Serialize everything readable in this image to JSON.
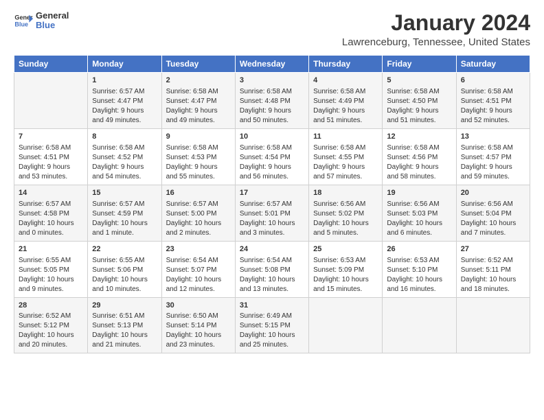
{
  "header": {
    "logo_line1": "General",
    "logo_line2": "Blue",
    "title": "January 2024",
    "subtitle": "Lawrenceburg, Tennessee, United States"
  },
  "days_of_week": [
    "Sunday",
    "Monday",
    "Tuesday",
    "Wednesday",
    "Thursday",
    "Friday",
    "Saturday"
  ],
  "weeks": [
    [
      {
        "day": "",
        "info": ""
      },
      {
        "day": "1",
        "info": "Sunrise: 6:57 AM\nSunset: 4:47 PM\nDaylight: 9 hours\nand 49 minutes."
      },
      {
        "day": "2",
        "info": "Sunrise: 6:58 AM\nSunset: 4:47 PM\nDaylight: 9 hours\nand 49 minutes."
      },
      {
        "day": "3",
        "info": "Sunrise: 6:58 AM\nSunset: 4:48 PM\nDaylight: 9 hours\nand 50 minutes."
      },
      {
        "day": "4",
        "info": "Sunrise: 6:58 AM\nSunset: 4:49 PM\nDaylight: 9 hours\nand 51 minutes."
      },
      {
        "day": "5",
        "info": "Sunrise: 6:58 AM\nSunset: 4:50 PM\nDaylight: 9 hours\nand 51 minutes."
      },
      {
        "day": "6",
        "info": "Sunrise: 6:58 AM\nSunset: 4:51 PM\nDaylight: 9 hours\nand 52 minutes."
      }
    ],
    [
      {
        "day": "7",
        "info": "Sunrise: 6:58 AM\nSunset: 4:51 PM\nDaylight: 9 hours\nand 53 minutes."
      },
      {
        "day": "8",
        "info": "Sunrise: 6:58 AM\nSunset: 4:52 PM\nDaylight: 9 hours\nand 54 minutes."
      },
      {
        "day": "9",
        "info": "Sunrise: 6:58 AM\nSunset: 4:53 PM\nDaylight: 9 hours\nand 55 minutes."
      },
      {
        "day": "10",
        "info": "Sunrise: 6:58 AM\nSunset: 4:54 PM\nDaylight: 9 hours\nand 56 minutes."
      },
      {
        "day": "11",
        "info": "Sunrise: 6:58 AM\nSunset: 4:55 PM\nDaylight: 9 hours\nand 57 minutes."
      },
      {
        "day": "12",
        "info": "Sunrise: 6:58 AM\nSunset: 4:56 PM\nDaylight: 9 hours\nand 58 minutes."
      },
      {
        "day": "13",
        "info": "Sunrise: 6:58 AM\nSunset: 4:57 PM\nDaylight: 9 hours\nand 59 minutes."
      }
    ],
    [
      {
        "day": "14",
        "info": "Sunrise: 6:57 AM\nSunset: 4:58 PM\nDaylight: 10 hours\nand 0 minutes."
      },
      {
        "day": "15",
        "info": "Sunrise: 6:57 AM\nSunset: 4:59 PM\nDaylight: 10 hours\nand 1 minute."
      },
      {
        "day": "16",
        "info": "Sunrise: 6:57 AM\nSunset: 5:00 PM\nDaylight: 10 hours\nand 2 minutes."
      },
      {
        "day": "17",
        "info": "Sunrise: 6:57 AM\nSunset: 5:01 PM\nDaylight: 10 hours\nand 3 minutes."
      },
      {
        "day": "18",
        "info": "Sunrise: 6:56 AM\nSunset: 5:02 PM\nDaylight: 10 hours\nand 5 minutes."
      },
      {
        "day": "19",
        "info": "Sunrise: 6:56 AM\nSunset: 5:03 PM\nDaylight: 10 hours\nand 6 minutes."
      },
      {
        "day": "20",
        "info": "Sunrise: 6:56 AM\nSunset: 5:04 PM\nDaylight: 10 hours\nand 7 minutes."
      }
    ],
    [
      {
        "day": "21",
        "info": "Sunrise: 6:55 AM\nSunset: 5:05 PM\nDaylight: 10 hours\nand 9 minutes."
      },
      {
        "day": "22",
        "info": "Sunrise: 6:55 AM\nSunset: 5:06 PM\nDaylight: 10 hours\nand 10 minutes."
      },
      {
        "day": "23",
        "info": "Sunrise: 6:54 AM\nSunset: 5:07 PM\nDaylight: 10 hours\nand 12 minutes."
      },
      {
        "day": "24",
        "info": "Sunrise: 6:54 AM\nSunset: 5:08 PM\nDaylight: 10 hours\nand 13 minutes."
      },
      {
        "day": "25",
        "info": "Sunrise: 6:53 AM\nSunset: 5:09 PM\nDaylight: 10 hours\nand 15 minutes."
      },
      {
        "day": "26",
        "info": "Sunrise: 6:53 AM\nSunset: 5:10 PM\nDaylight: 10 hours\nand 16 minutes."
      },
      {
        "day": "27",
        "info": "Sunrise: 6:52 AM\nSunset: 5:11 PM\nDaylight: 10 hours\nand 18 minutes."
      }
    ],
    [
      {
        "day": "28",
        "info": "Sunrise: 6:52 AM\nSunset: 5:12 PM\nDaylight: 10 hours\nand 20 minutes."
      },
      {
        "day": "29",
        "info": "Sunrise: 6:51 AM\nSunset: 5:13 PM\nDaylight: 10 hours\nand 21 minutes."
      },
      {
        "day": "30",
        "info": "Sunrise: 6:50 AM\nSunset: 5:14 PM\nDaylight: 10 hours\nand 23 minutes."
      },
      {
        "day": "31",
        "info": "Sunrise: 6:49 AM\nSunset: 5:15 PM\nDaylight: 10 hours\nand 25 minutes."
      },
      {
        "day": "",
        "info": ""
      },
      {
        "day": "",
        "info": ""
      },
      {
        "day": "",
        "info": ""
      }
    ]
  ]
}
